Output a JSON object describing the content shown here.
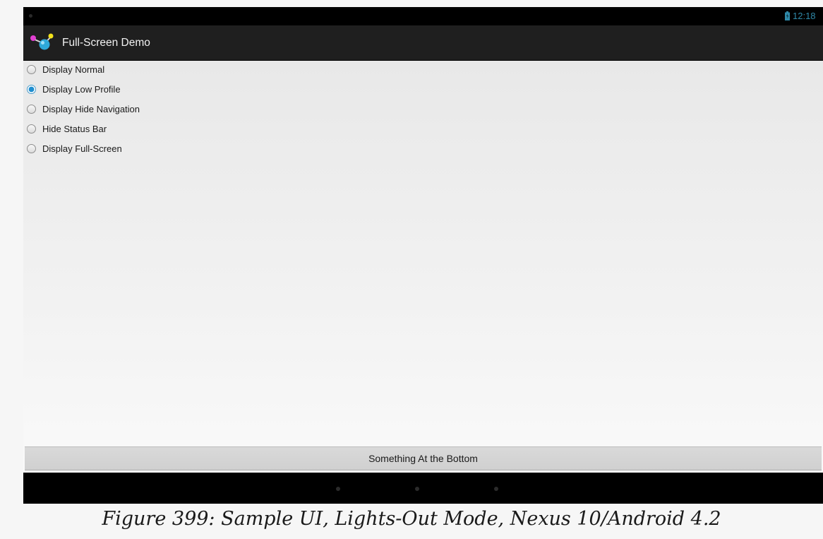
{
  "status_bar": {
    "time": "12:18",
    "battery_icon": "battery-charging-icon",
    "accent_color": "#2f89a8"
  },
  "action_bar": {
    "app_icon": "molecule-app-icon",
    "title": "Full-Screen Demo"
  },
  "radio_options": [
    {
      "label": "Display Normal",
      "checked": false
    },
    {
      "label": "Display Low Profile",
      "checked": true
    },
    {
      "label": "Display Hide Navigation",
      "checked": false
    },
    {
      "label": "Hide Status Bar",
      "checked": false
    },
    {
      "label": "Display Full-Screen",
      "checked": false
    }
  ],
  "bottom_button": {
    "label": "Something At the Bottom"
  },
  "nav_bar": {
    "buttons": [
      "back-dot-icon",
      "home-dot-icon",
      "recents-dot-icon"
    ],
    "mode": "lights-out"
  },
  "caption": "Figure 399: Sample UI, Lights-Out Mode, Nexus 10/Android 4.2",
  "colors": {
    "radio_selected": "#1f8ed0",
    "action_bar": "#1f1f1f"
  }
}
